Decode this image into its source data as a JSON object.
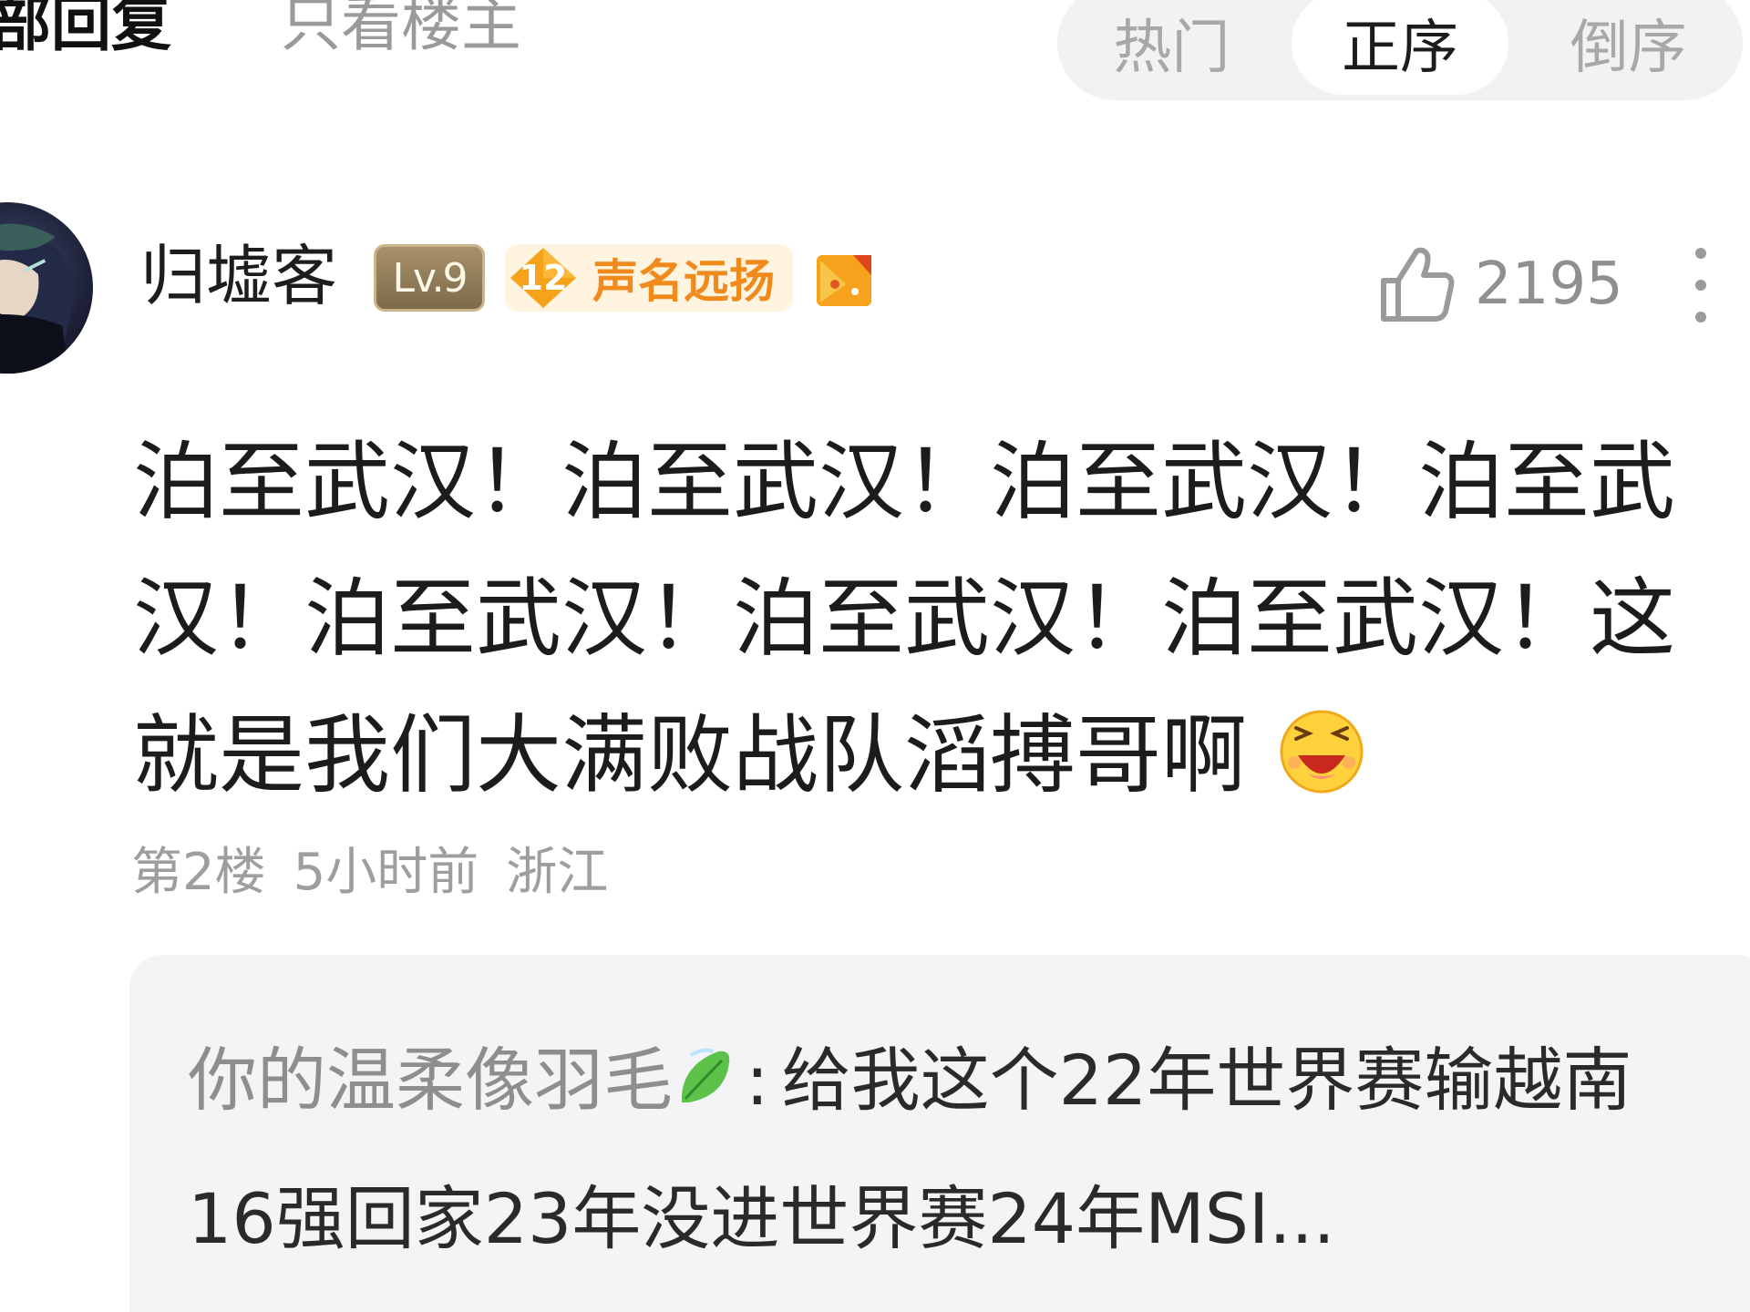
{
  "filter": {
    "all_replies": "部回复",
    "op_only": "只看楼主"
  },
  "sort": {
    "tabs": [
      {
        "label": "热门",
        "active": false
      },
      {
        "label": "正序",
        "active": true
      },
      {
        "label": "倒序",
        "active": false
      }
    ]
  },
  "post": {
    "username": "归墟客",
    "level_badge": "Lv.9",
    "fame_level": "12",
    "fame_title": "声名远扬",
    "likes": "2195",
    "content": "泊至武汉！泊至武汉！泊至武汉！泊至武汉！泊至武汉！泊至武汉！泊至武汉！这就是我们大满败战队滔搏哥啊",
    "emoji": "laughing-emoji",
    "floor": "第2楼",
    "time": "5小时前",
    "location": "浙江"
  },
  "reply": {
    "author": "你的温柔像羽毛",
    "author_icon": "leaf-icon",
    "separator": ":",
    "content": "给我这个22年世界赛输越南16强回家23年没进世界赛24年MSI..."
  },
  "colors": {
    "accent_orange": "#f08a1c",
    "muted_text": "#9e9e9e",
    "reply_bg": "#f4f4f6",
    "sort_bg": "#f2f2f4"
  }
}
